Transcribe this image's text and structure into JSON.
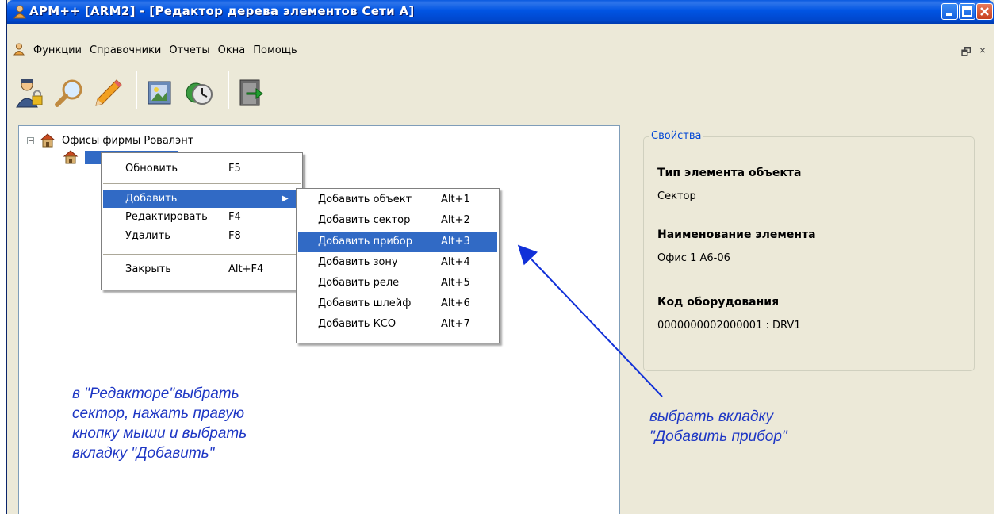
{
  "window": {
    "title": "АРМ++ [ARM2] - [Редактор дерева элементов Сети А]"
  },
  "menu": {
    "items": [
      "Функции",
      "Справочники",
      "Отчеты",
      "Окна",
      "Помощь"
    ],
    "mdi_controls": [
      "_",
      "🗗",
      "×"
    ]
  },
  "toolbar": {
    "icons": [
      "user-lock-icon",
      "search-icon",
      "pencil-icon",
      "gallery-icon",
      "clock-icon",
      "exit-door-icon"
    ]
  },
  "tree": {
    "root_label": "Офисы фирмы Ровалэнт",
    "root_expander": "−"
  },
  "context_menu": {
    "items": [
      {
        "label": "Обновить",
        "shortcut": "F5"
      },
      {
        "label": "Добавить",
        "shortcut": "▶"
      },
      {
        "label": "Редактировать",
        "shortcut": "F4"
      },
      {
        "label": "Удалить",
        "shortcut": "F8"
      },
      {
        "label": "Закрыть",
        "shortcut": "Alt+F4"
      }
    ]
  },
  "submenu": {
    "items": [
      {
        "label": "Добавить объект",
        "shortcut": "Alt+1"
      },
      {
        "label": "Добавить сектор",
        "shortcut": "Alt+2"
      },
      {
        "label": "Добавить прибор",
        "shortcut": "Alt+3"
      },
      {
        "label": "Добавить зону",
        "shortcut": "Alt+4"
      },
      {
        "label": "Добавить реле",
        "shortcut": "Alt+5"
      },
      {
        "label": "Добавить шлейф",
        "shortcut": "Alt+6"
      },
      {
        "label": "Добавить КСО",
        "shortcut": "Alt+7"
      }
    ]
  },
  "properties": {
    "legend": "Свойства",
    "type_label": "Тип элемента объекта",
    "type_value": "Сектор",
    "name_label": "Наименование элемента",
    "name_value": "Офис 1 А6-06",
    "code_label": "Код оборудования",
    "code_value": "0000000002000001 : DRV1"
  },
  "annotations": {
    "left": [
      "в \"Редакторе\"выбрать",
      "сектор, нажать правую",
      "кнопку мыши  и выбрать",
      "вкладку \"Добавить\""
    ],
    "right": [
      "выбрать вкладку",
      "\"Добавить прибор\""
    ]
  },
  "colors": {
    "highlight": "#316ac5",
    "annotation": "#1d36c4",
    "titlebar": "#0054e3"
  }
}
